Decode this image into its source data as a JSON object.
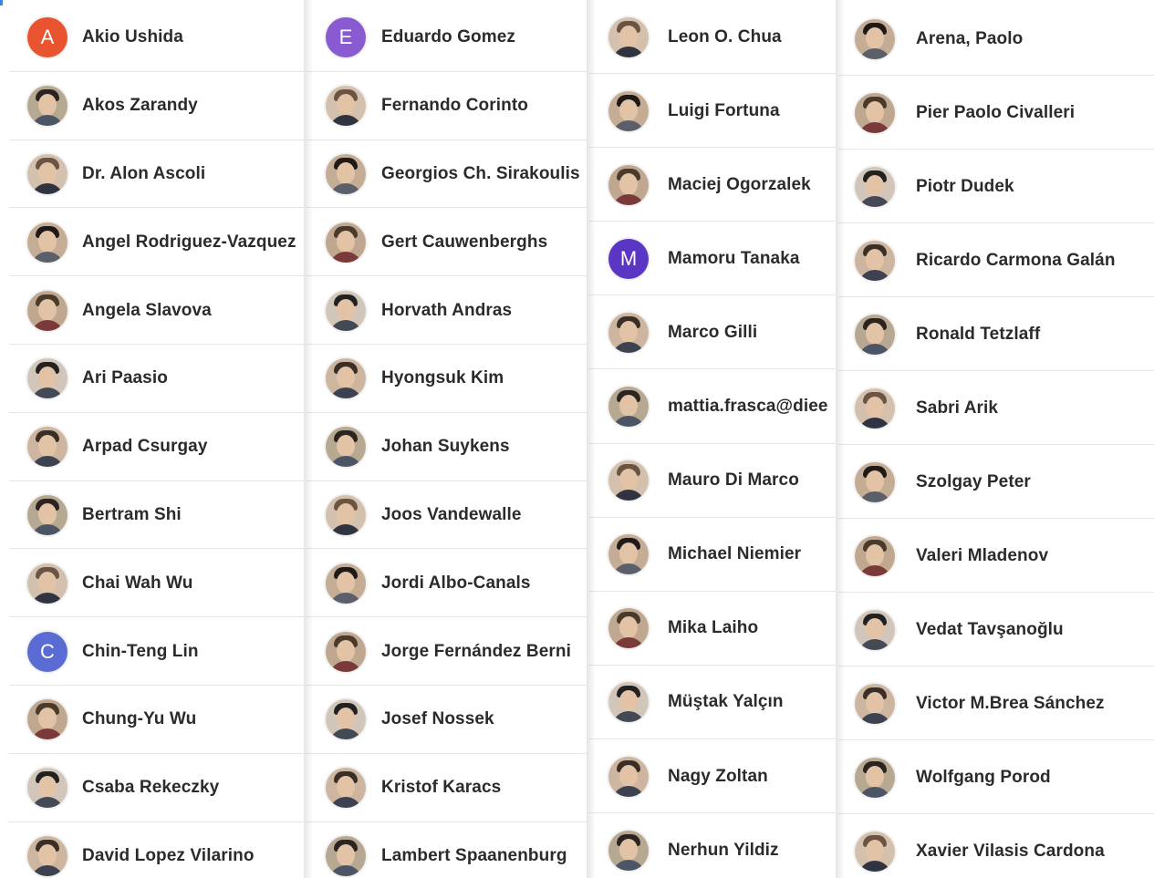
{
  "columns": [
    [
      {
        "name": "Akio Ushida",
        "avatar": {
          "type": "letter",
          "letter": "A",
          "color": "#e8542f"
        }
      },
      {
        "name": "Akos Zarandy",
        "avatar": {
          "type": "photo"
        }
      },
      {
        "name": "Dr. Alon Ascoli",
        "avatar": {
          "type": "photo"
        }
      },
      {
        "name": "Angel Rodriguez-Vazquez",
        "avatar": {
          "type": "photo"
        }
      },
      {
        "name": "Angela Slavova",
        "avatar": {
          "type": "photo"
        }
      },
      {
        "name": "Ari Paasio",
        "avatar": {
          "type": "photo"
        }
      },
      {
        "name": "Arpad Csurgay",
        "avatar": {
          "type": "photo"
        }
      },
      {
        "name": "Bertram Shi",
        "avatar": {
          "type": "photo"
        }
      },
      {
        "name": "Chai Wah Wu",
        "avatar": {
          "type": "photo"
        }
      },
      {
        "name": "Chin-Teng Lin",
        "avatar": {
          "type": "letter",
          "letter": "C",
          "color": "#5a6bd4"
        }
      },
      {
        "name": "Chung-Yu Wu",
        "avatar": {
          "type": "photo"
        }
      },
      {
        "name": "Csaba Rekeczky",
        "avatar": {
          "type": "photo"
        }
      },
      {
        "name": "David Lopez Vilarino",
        "avatar": {
          "type": "photo"
        }
      }
    ],
    [
      {
        "name": "Eduardo Gomez",
        "avatar": {
          "type": "letter",
          "letter": "E",
          "color": "#8a5bd0"
        }
      },
      {
        "name": "Fernando Corinto",
        "avatar": {
          "type": "photo"
        }
      },
      {
        "name": "Georgios Ch. Sirakoulis",
        "avatar": {
          "type": "photo"
        }
      },
      {
        "name": "Gert Cauwenberghs",
        "avatar": {
          "type": "photo"
        }
      },
      {
        "name": "Horvath Andras",
        "avatar": {
          "type": "photo"
        }
      },
      {
        "name": "Hyongsuk Kim",
        "avatar": {
          "type": "photo"
        }
      },
      {
        "name": "Johan Suykens",
        "avatar": {
          "type": "photo"
        }
      },
      {
        "name": "Joos Vandewalle",
        "avatar": {
          "type": "photo"
        }
      },
      {
        "name": "Jordi Albo-Canals",
        "avatar": {
          "type": "photo"
        }
      },
      {
        "name": "Jorge Fernández Berni",
        "avatar": {
          "type": "photo"
        }
      },
      {
        "name": "Josef Nossek",
        "avatar": {
          "type": "photo"
        }
      },
      {
        "name": "Kristof Karacs",
        "avatar": {
          "type": "photo"
        }
      },
      {
        "name": "Lambert Spaanenburg",
        "avatar": {
          "type": "photo"
        }
      }
    ],
    [
      {
        "name": "Leon O. Chua",
        "avatar": {
          "type": "photo"
        }
      },
      {
        "name": "Luigi Fortuna",
        "avatar": {
          "type": "photo"
        }
      },
      {
        "name": "Maciej Ogorzalek",
        "avatar": {
          "type": "photo"
        }
      },
      {
        "name": "Mamoru Tanaka",
        "avatar": {
          "type": "letter",
          "letter": "M",
          "color": "#5b36c4"
        }
      },
      {
        "name": "Marco Gilli",
        "avatar": {
          "type": "photo"
        }
      },
      {
        "name": "mattia.frasca@diee",
        "avatar": {
          "type": "photo"
        }
      },
      {
        "name": "Mauro Di Marco",
        "avatar": {
          "type": "photo"
        }
      },
      {
        "name": "Michael Niemier",
        "avatar": {
          "type": "photo"
        }
      },
      {
        "name": "Mika Laiho",
        "avatar": {
          "type": "photo"
        }
      },
      {
        "name": "Müştak Yalçın",
        "avatar": {
          "type": "photo"
        }
      },
      {
        "name": "Nagy Zoltan",
        "avatar": {
          "type": "photo"
        }
      },
      {
        "name": "Nerhun Yildiz",
        "avatar": {
          "type": "photo"
        }
      }
    ],
    [
      {
        "name": "Arena, Paolo",
        "avatar": {
          "type": "photo"
        }
      },
      {
        "name": "Pier Paolo Civalleri",
        "avatar": {
          "type": "photo"
        }
      },
      {
        "name": "Piotr Dudek",
        "avatar": {
          "type": "photo"
        }
      },
      {
        "name": "Ricardo Carmona Galán",
        "avatar": {
          "type": "photo"
        }
      },
      {
        "name": "Ronald Tetzlaff",
        "avatar": {
          "type": "photo"
        }
      },
      {
        "name": "Sabri Arik",
        "avatar": {
          "type": "photo"
        }
      },
      {
        "name": "Szolgay Peter",
        "avatar": {
          "type": "photo"
        }
      },
      {
        "name": "Valeri Mladenov",
        "avatar": {
          "type": "photo"
        }
      },
      {
        "name": "Vedat Tavşanoğlu",
        "avatar": {
          "type": "photo"
        }
      },
      {
        "name": "Victor M.Brea Sánchez",
        "avatar": {
          "type": "photo"
        }
      },
      {
        "name": "Wolfgang Porod",
        "avatar": {
          "type": "photo"
        }
      },
      {
        "name": "Xavier Vilasis Cardona",
        "avatar": {
          "type": "photo"
        }
      }
    ]
  ]
}
